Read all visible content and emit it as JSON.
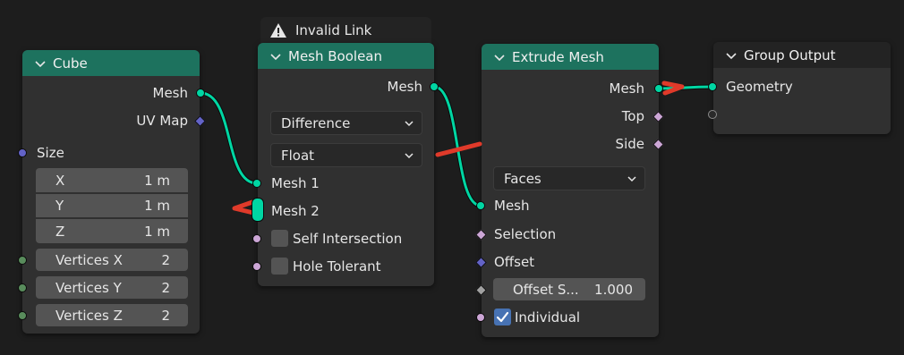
{
  "colors": {
    "geometry_socket": "#00d6a3",
    "vector_socket": "#6363c7",
    "integer_socket": "#598c5c",
    "boolean_socket": "#cca6d6",
    "node_header_geometry": "#1d725e",
    "node_header_output": "#232323",
    "invalid_link": "#e03a2a",
    "checkbox_on": "#4772b3"
  },
  "cube": {
    "title": "Cube",
    "out_mesh": "Mesh",
    "out_uvmap": "UV Map",
    "size_label": "Size",
    "x_label": "X",
    "x_value": "1 m",
    "y_label": "Y",
    "y_value": "1 m",
    "z_label": "Z",
    "z_value": "1 m",
    "vx_label": "Vertices X",
    "vx_value": "2",
    "vy_label": "Vertices Y",
    "vy_value": "2",
    "vz_label": "Vertices Z",
    "vz_value": "2"
  },
  "boolean": {
    "warning": "Invalid Link",
    "title": "Mesh Boolean",
    "out_mesh": "Mesh",
    "operation": "Difference",
    "solver": "Float",
    "in_mesh1": "Mesh 1",
    "in_mesh2": "Mesh 2",
    "self_intersection": "Self Intersection",
    "hole_tolerant": "Hole Tolerant"
  },
  "extrude": {
    "title": "Extrude Mesh",
    "out_mesh": "Mesh",
    "out_top": "Top",
    "out_side": "Side",
    "mode": "Faces",
    "in_mesh": "Mesh",
    "in_selection": "Selection",
    "in_offset": "Offset",
    "offset_scale_label": "Offset S...",
    "offset_scale_value": "1.000",
    "individual": "Individual",
    "individual_checked": true
  },
  "output": {
    "title": "Group Output",
    "in_geometry": "Geometry"
  }
}
